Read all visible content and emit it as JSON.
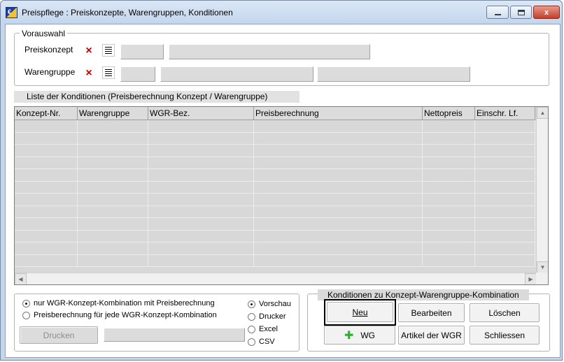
{
  "window": {
    "title": "Preispflege : Preiskonzepte, Warengruppen, Konditionen",
    "min_label": "",
    "max_label": "",
    "close_label": "x"
  },
  "vorauswahl": {
    "legend": "Vorauswahl",
    "preiskonzept_label": "Preiskonzept",
    "warengruppe_label": "Warengruppe"
  },
  "list": {
    "title": "Liste der Konditionen (Preisberechnung Konzept / Warengruppe)",
    "columns": [
      "Konzept-Nr.",
      "Warengruppe",
      "WGR-Bez.",
      "Preisberechnung",
      "Nettopreis",
      "Einschr. Lf."
    ]
  },
  "print_options": {
    "radio_combo_only": "nur WGR-Konzept-Kombination mit Preisberechnung",
    "radio_each_combo": "Preisberechnung für jede WGR-Konzept-Kombination",
    "output_vorschau": "Vorschau",
    "output_drucker": "Drucker",
    "output_excel": "Excel",
    "output_csv": "CSV",
    "drucken_label": "Drucken"
  },
  "konditionen": {
    "legend": "Konditionen zu Konzept-Warengruppe-Kombination",
    "neu_label": "Neu",
    "bearbeiten_label": "Bearbeiten",
    "loeschen_label": "Löschen",
    "wg_label": "WG",
    "artikel_label": "Artikel der WGR",
    "schliessen_label": "Schliessen"
  },
  "colors": {
    "title_bg": "#c3d6ec",
    "close_btn": "#c2402c",
    "x_icon": "#c00000",
    "plus_icon": "#2fb12f"
  },
  "icons": {
    "clear": "x-icon",
    "list": "list-icon",
    "add": "plus-icon"
  }
}
